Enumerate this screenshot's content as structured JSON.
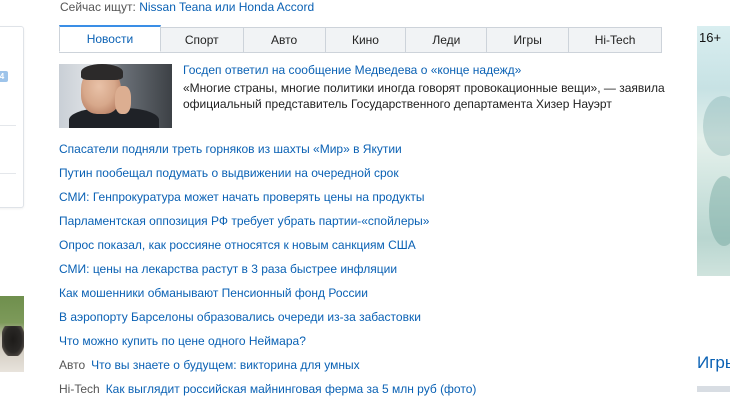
{
  "searching": {
    "label": "Сейчас ищут:",
    "query": "Nissan Teana или Honda Accord"
  },
  "left": {
    "badge": "4"
  },
  "tabs": [
    {
      "label": "Новости",
      "active": true
    },
    {
      "label": "Спорт",
      "active": false
    },
    {
      "label": "Авто",
      "active": false
    },
    {
      "label": "Кино",
      "active": false
    },
    {
      "label": "Леди",
      "active": false
    },
    {
      "label": "Игры",
      "active": false
    },
    {
      "label": "Hi-Tech",
      "active": false
    }
  ],
  "featured": {
    "title": "Госдеп ответил на сообщение Медведева о «конце надежд»",
    "description": "«Многие страны, многие политики иногда говорят провокационные вещи», — заявила официальный представитель Государственного департамента Хизер Науэрт"
  },
  "news": [
    {
      "category": "",
      "title": "Спасатели подняли треть горняков из шахты «Мир» в Якутии"
    },
    {
      "category": "",
      "title": "Путин пообещал подумать о выдвижении на очередной срок"
    },
    {
      "category": "",
      "title": "СМИ: Генпрокуратура может начать проверять цены на продукты"
    },
    {
      "category": "",
      "title": "Парламентская оппозиция РФ требует убрать партии-«спойлеры»"
    },
    {
      "category": "",
      "title": "Опрос показал, как россияне относятся к новым санкциям США"
    },
    {
      "category": "",
      "title": "СМИ: цены на лекарства растут в 3 раза быстрее инфляции"
    },
    {
      "category": "",
      "title": "Как мошенники обманывают Пенсионный фонд России"
    },
    {
      "category": "",
      "title": "В аэропорту Барселоны образовались очереди из-за забастовки"
    },
    {
      "category": "",
      "title": "Что можно купить по цене одного Неймара?"
    },
    {
      "category": "Авто",
      "title": "Что вы знаете о будущем: викторина для умных"
    },
    {
      "category": "Hi-Tech",
      "title": "Как выглядит российская майнинговая ферма за 5 млн руб (фото)"
    }
  ],
  "right": {
    "age_rating": "16+",
    "heading": "Игры"
  },
  "colors": {
    "link": "#0a61b4",
    "tab_active_border": "#3a8ee6",
    "tab_bg": "#f1f3f5"
  }
}
